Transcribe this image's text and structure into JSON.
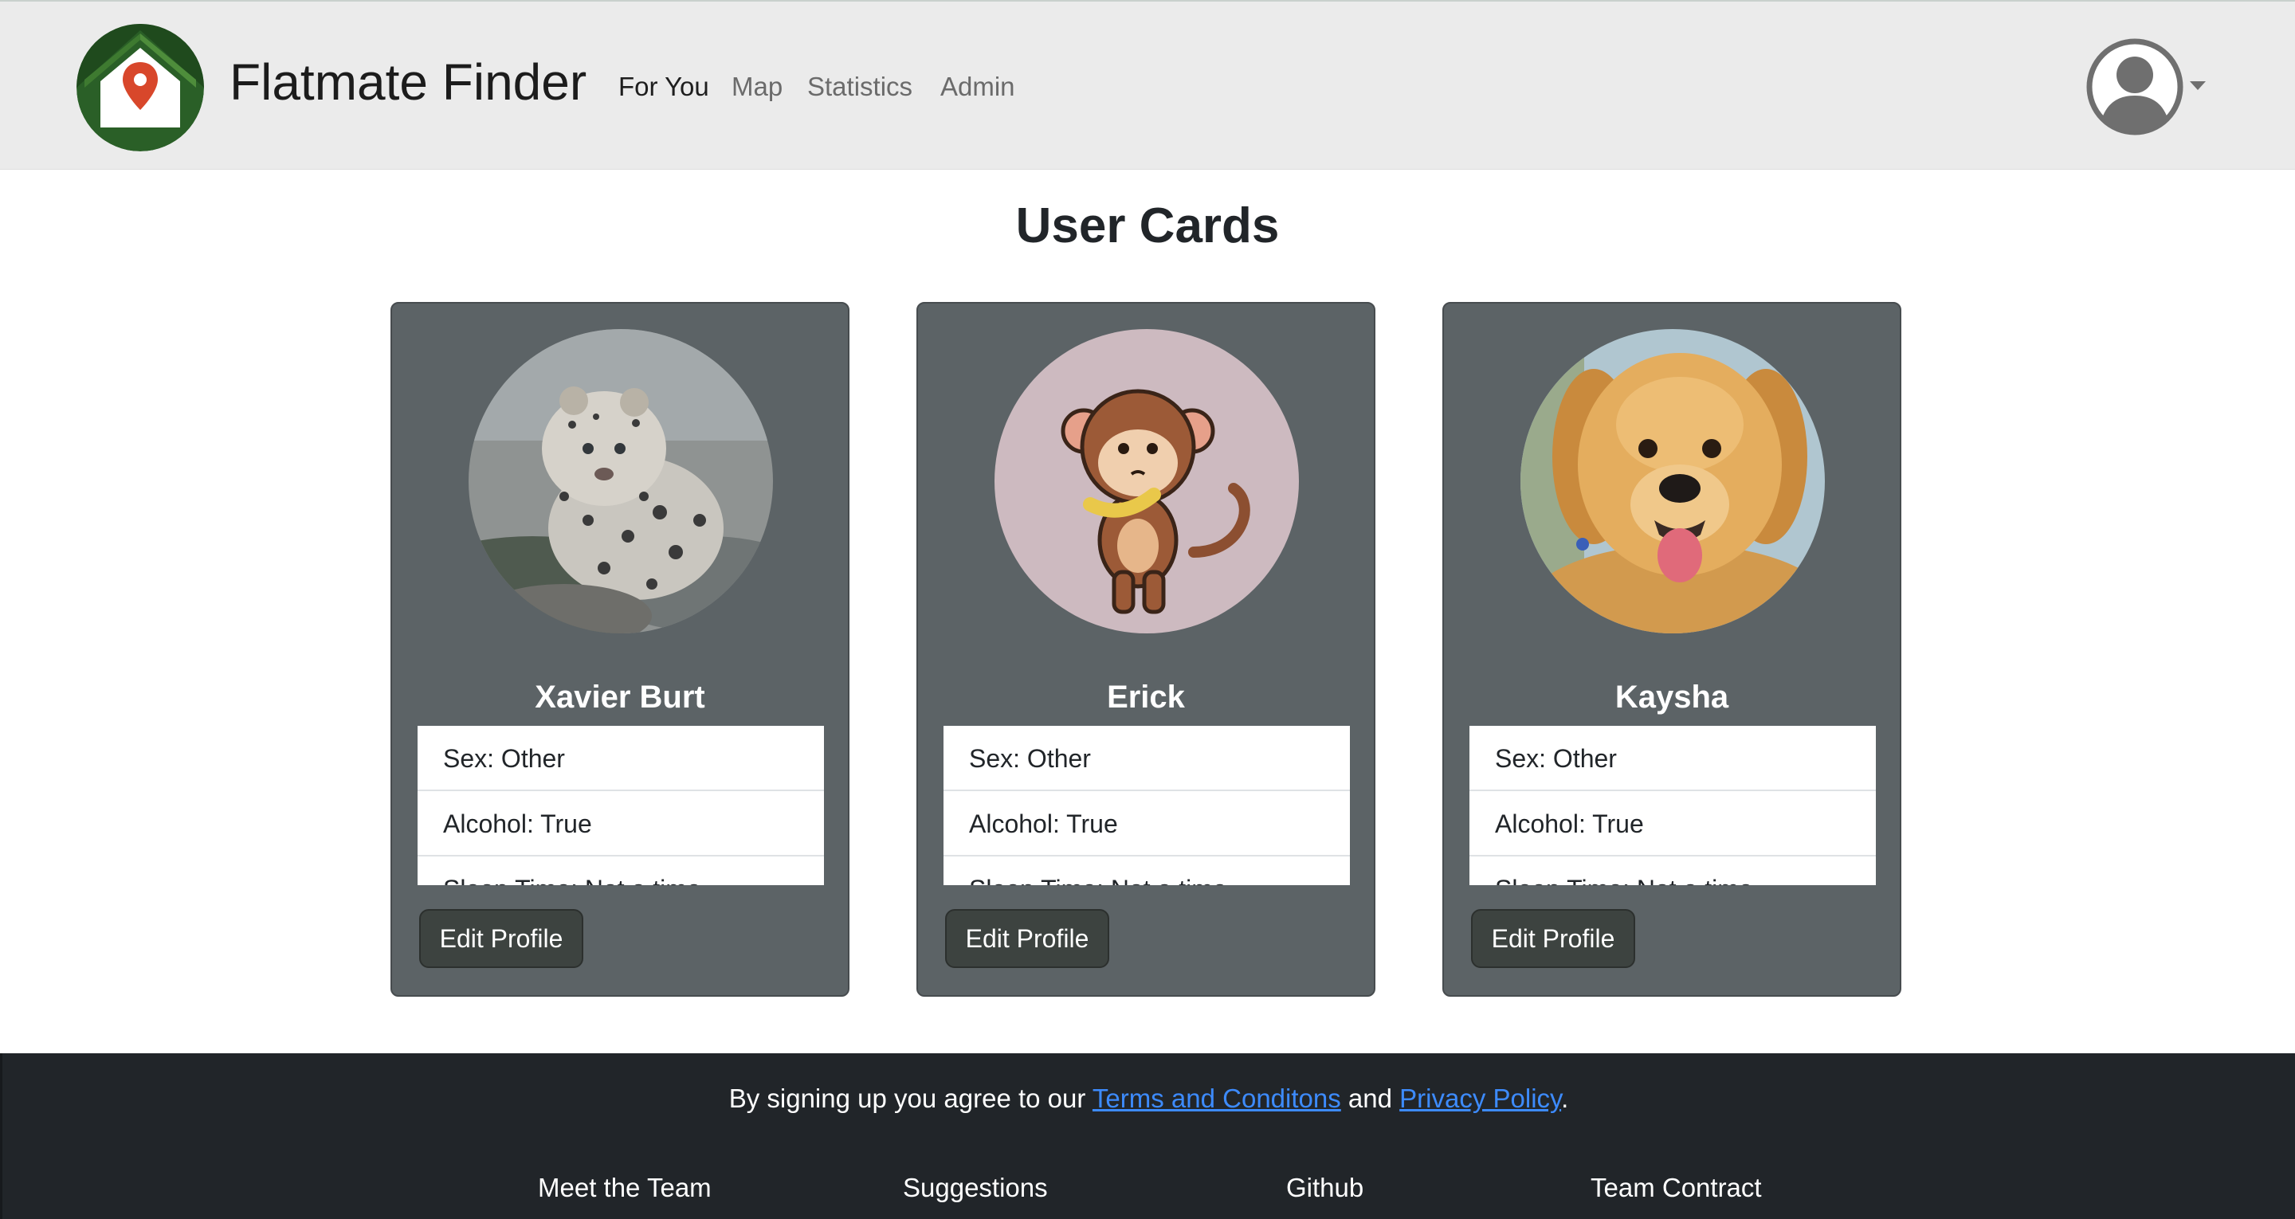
{
  "navbar": {
    "brand": "Flatmate Finder",
    "links": [
      {
        "label": "For You",
        "active": true
      },
      {
        "label": "Map",
        "active": false
      },
      {
        "label": "Statistics",
        "active": false
      },
      {
        "label": "Admin",
        "active": false
      }
    ],
    "logo_icon": "house-location-pin-logo",
    "user_icon": "user-avatar-icon",
    "dropdown_icon": "caret-down-icon"
  },
  "main": {
    "title": "User Cards",
    "cards": [
      {
        "name": "Xavier Burt",
        "avatar": "snow-leopard-cub-photo",
        "attributes": [
          "Sex: Other",
          "Alcohol: True",
          "Sleep Time: Not a time"
        ],
        "button": "Edit Profile"
      },
      {
        "name": "Erick",
        "avatar": "cartoon-monkey-illustration",
        "attributes": [
          "Sex: Other",
          "Alcohol: True",
          "Sleep Time: Not a time"
        ],
        "button": "Edit Profile"
      },
      {
        "name": "Kaysha",
        "avatar": "golden-retriever-puppy-photo",
        "attributes": [
          "Sex: Other",
          "Alcohol: True",
          "Sleep Time: Not a time"
        ],
        "button": "Edit Profile"
      }
    ]
  },
  "footer": {
    "consent_prefix": "By signing up you agree to our ",
    "terms_link": "Terms and Conditons",
    "consent_middle": " and ",
    "privacy_link": "Privacy Policy",
    "consent_suffix": ".",
    "links": [
      "Meet the Team",
      "Suggestions",
      "Github",
      "Team Contract"
    ]
  },
  "colors": {
    "navbar_bg": "#ebebeb",
    "card_bg": "#5c6366",
    "footer_bg": "#212529",
    "link": "#3d8bfd",
    "logo_green": "#2e6b2a",
    "pin_red": "#d8472b"
  }
}
